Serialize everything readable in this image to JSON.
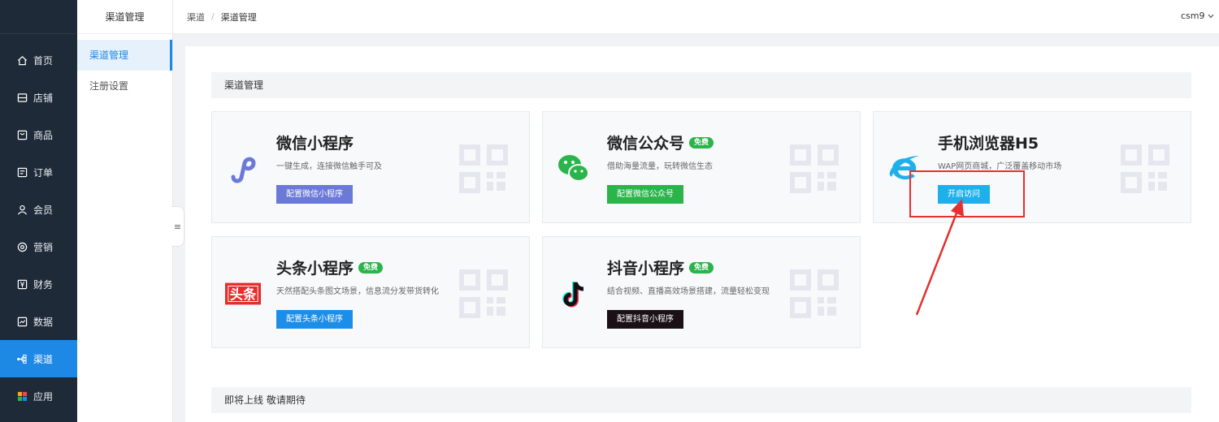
{
  "nav": {
    "items": [
      {
        "label": "首页",
        "icon": "home-icon"
      },
      {
        "label": "店铺",
        "icon": "shop-icon"
      },
      {
        "label": "商品",
        "icon": "goods-icon"
      },
      {
        "label": "订单",
        "icon": "order-icon"
      },
      {
        "label": "会员",
        "icon": "user-icon"
      },
      {
        "label": "营销",
        "icon": "marketing-icon"
      },
      {
        "label": "财务",
        "icon": "finance-icon"
      },
      {
        "label": "数据",
        "icon": "data-icon"
      },
      {
        "label": "渠道",
        "icon": "channel-icon",
        "active": true
      },
      {
        "label": "应用",
        "icon": "apps-icon"
      }
    ]
  },
  "subnav": {
    "title": "渠道管理",
    "items": [
      {
        "label": "渠道管理",
        "active": true
      },
      {
        "label": "注册设置"
      }
    ]
  },
  "breadcrumb": {
    "root": "渠道",
    "separator": "/",
    "current": "渠道管理"
  },
  "user": {
    "name": "csm9"
  },
  "sections": {
    "channels_title": "渠道管理",
    "upcoming_title": "即将上线 敬请期待"
  },
  "cards": [
    {
      "title": "微信小程序",
      "badge": "",
      "desc": "一键生成，连接微信触手可及",
      "button": "配置微信小程序",
      "button_color": "#6b79d8"
    },
    {
      "title": "微信公众号",
      "badge": "免费",
      "desc": "借助海量流量，玩转微信生态",
      "button": "配置微信公众号",
      "button_color": "#2bb44a"
    },
    {
      "title": "手机浏览器H5",
      "badge": "",
      "desc": "WAP网页商城，广泛覆盖移动市场",
      "button": "开启访问",
      "button_color": "#1fb0ec"
    },
    {
      "title": "头条小程序",
      "badge": "免费",
      "desc": "天然搭配头条图文场景，信息流分发带货转化",
      "button": "配置头条小程序",
      "button_color": "#1d8ee8"
    },
    {
      "title": "抖音小程序",
      "badge": "免费",
      "desc": "结合视频、直播高效场景搭建，流量轻松变现",
      "button": "配置抖音小程序",
      "button_color": "#1a1016"
    }
  ],
  "colors": {
    "accent": "#1e88e5",
    "nav_bg": "#1f2a38",
    "annotation": "#e62f2f"
  }
}
